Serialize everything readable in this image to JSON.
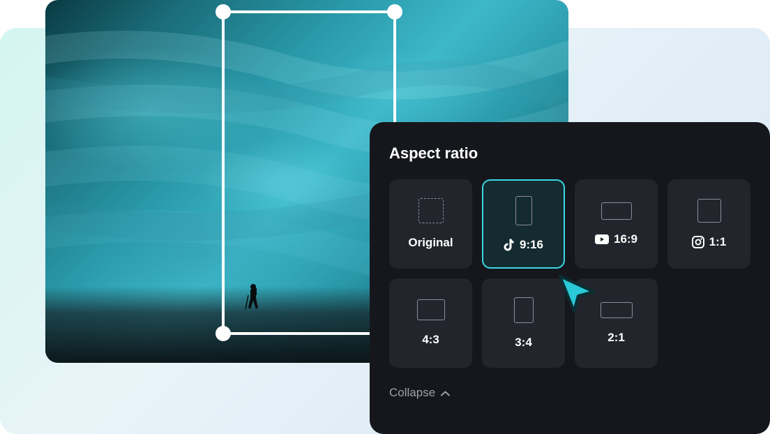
{
  "panel": {
    "title": "Aspect ratio",
    "collapse_label": "Collapse"
  },
  "ratios": [
    {
      "id": "original",
      "label": "Original",
      "shape": "shape-original",
      "dashed": true,
      "platform": null,
      "selected": false
    },
    {
      "id": "9-16",
      "label": "9:16",
      "shape": "shape-916",
      "dashed": false,
      "platform": "tiktok",
      "selected": true
    },
    {
      "id": "16-9",
      "label": "16:9",
      "shape": "shape-169",
      "dashed": false,
      "platform": "youtube",
      "selected": false
    },
    {
      "id": "1-1",
      "label": "1:1",
      "shape": "shape-11",
      "dashed": false,
      "platform": "instagram",
      "selected": false
    },
    {
      "id": "4-3",
      "label": "4:3",
      "shape": "shape-43",
      "dashed": false,
      "platform": null,
      "selected": false
    },
    {
      "id": "3-4",
      "label": "3:4",
      "shape": "shape-34",
      "dashed": false,
      "platform": null,
      "selected": false
    },
    {
      "id": "2-1",
      "label": "2:1",
      "shape": "shape-21",
      "dashed": false,
      "platform": null,
      "selected": false
    }
  ],
  "colors": {
    "accent": "#3dd8e0",
    "panel_bg": "#15171c",
    "card_bg": "#22252c"
  }
}
